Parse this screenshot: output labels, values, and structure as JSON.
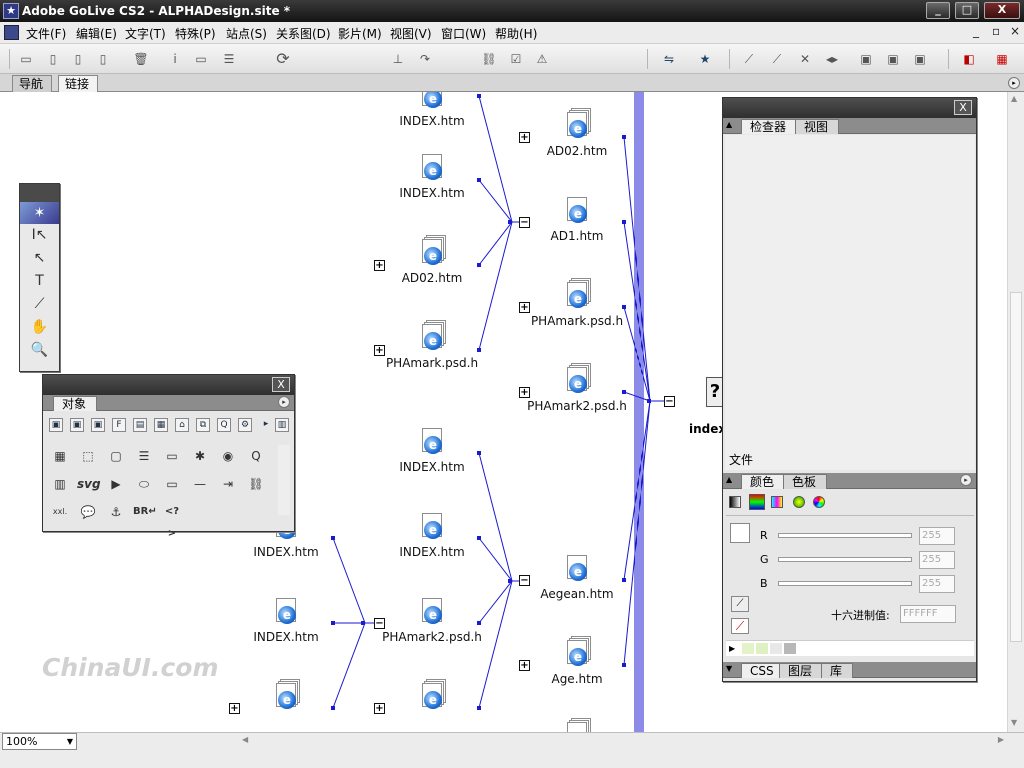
{
  "window": {
    "title": "Adobe GoLive CS2 - ALPHADesign.site *",
    "minimize": "_",
    "maximize": "□",
    "close": "X"
  },
  "menu": {
    "items": [
      "文件(F)",
      "编辑(E)",
      "文字(T)",
      "特殊(P)",
      "站点(S)",
      "关系图(D)",
      "影片(M)",
      "视图(V)",
      "窗口(W)",
      "帮助(H)"
    ],
    "doc_controls": [
      "_",
      "▫",
      "×"
    ]
  },
  "tabs": {
    "nav": "导航",
    "links": "链接"
  },
  "nodes": {
    "c1": [
      "INDEX.htm",
      "INDEX.htm",
      "AD02.htm",
      "PHAmark.psd.h",
      "INDEX.htm",
      "INDEX.htm",
      "PHAmark2.psd.h"
    ],
    "c2": [
      "AD02.htm",
      "AD1.htm",
      "PHAmark.psd.h",
      "PHAmark2.psd.h",
      "Aegean.htm",
      "Age.htm"
    ],
    "c0": [
      "INDEX.htm",
      "INDEX.htm"
    ],
    "root": "index"
  },
  "expanders": {
    "plus": "+",
    "minus": "−"
  },
  "object_panel": {
    "tab": "对象",
    "tag_glyphs": [
      "svg",
      "BR↵",
      "<?>",
      "xxl."
    ]
  },
  "inspector": {
    "tabs": [
      "检查器",
      "视图"
    ],
    "file_label": "文件",
    "color_tabs": [
      "颜色",
      "色板"
    ],
    "r_label": "R",
    "g_label": "G",
    "b_label": "B",
    "r_value": "255",
    "g_value": "255",
    "b_value": "255",
    "hex_label": "十六进制值:",
    "hex_value": "FFFFFF",
    "bottom_tabs": [
      "CSS",
      "图层",
      "库"
    ],
    "close": "X"
  },
  "status": {
    "zoom": "100%"
  },
  "watermark": "ChinaUI.com"
}
